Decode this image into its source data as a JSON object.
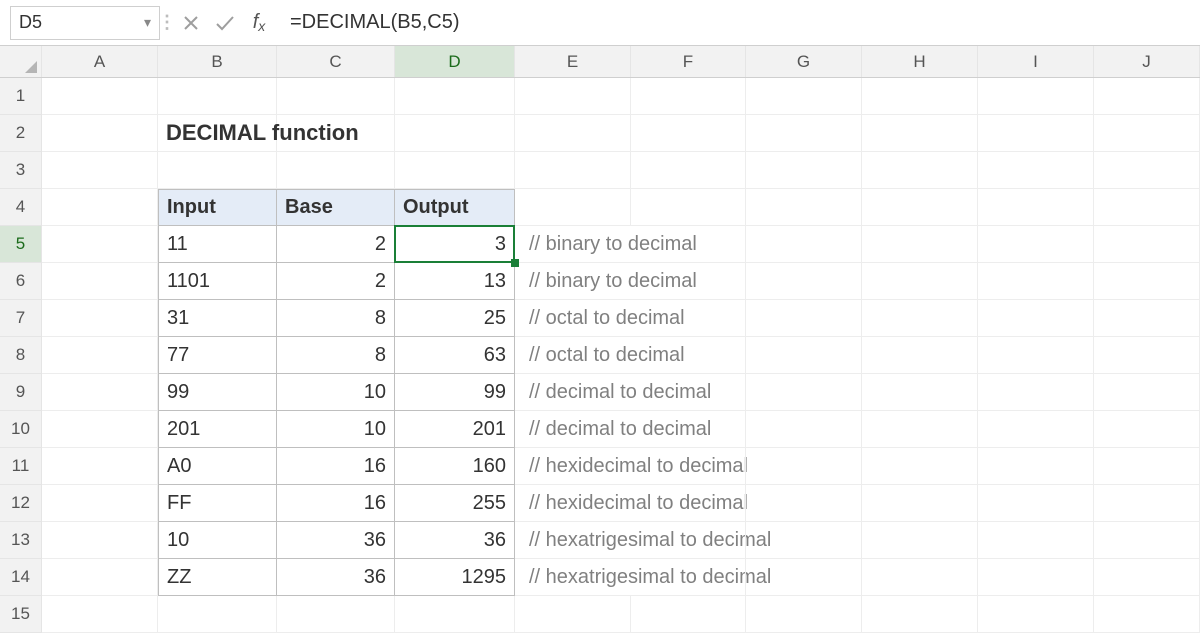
{
  "nameBox": "D5",
  "formula": "=DECIMAL(B5,C5)",
  "columns": [
    "A",
    "B",
    "C",
    "D",
    "E",
    "F",
    "G",
    "H",
    "I",
    "J"
  ],
  "colWidths": {
    "A": 116,
    "B": 119,
    "C": 118,
    "D": 120,
    "E": 116,
    "F": 115,
    "G": 116,
    "H": 116,
    "I": 116,
    "J": 106
  },
  "activeCol": "D",
  "rowLabels": [
    "1",
    "2",
    "3",
    "4",
    "5",
    "6",
    "7",
    "8",
    "9",
    "10",
    "11",
    "12",
    "13",
    "14",
    "15"
  ],
  "activeRow": "5",
  "title": "DECIMAL function",
  "headers": {
    "input": "Input",
    "base": "Base",
    "output": "Output"
  },
  "rows": [
    {
      "input": "11",
      "base": "2",
      "output": "3",
      "comment": "// binary to decimal"
    },
    {
      "input": "1101",
      "base": "2",
      "output": "13",
      "comment": "// binary to decimal"
    },
    {
      "input": "31",
      "base": "8",
      "output": "25",
      "comment": "// octal to decimal"
    },
    {
      "input": "77",
      "base": "8",
      "output": "63",
      "comment": "// octal to decimal"
    },
    {
      "input": "99",
      "base": "10",
      "output": "99",
      "comment": "// decimal to decimal"
    },
    {
      "input": "201",
      "base": "10",
      "output": "201",
      "comment": "// decimal to decimal"
    },
    {
      "input": "A0",
      "base": "16",
      "output": "160",
      "comment": "// hexidecimal to decimal"
    },
    {
      "input": "FF",
      "base": "16",
      "output": "255",
      "comment": "// hexidecimal to decimal"
    },
    {
      "input": "10",
      "base": "36",
      "output": "36",
      "comment": "// hexatrigesimal to decimal"
    },
    {
      "input": "ZZ",
      "base": "36",
      "output": "1295",
      "comment": "// hexatrigesimal to decimal"
    }
  ]
}
